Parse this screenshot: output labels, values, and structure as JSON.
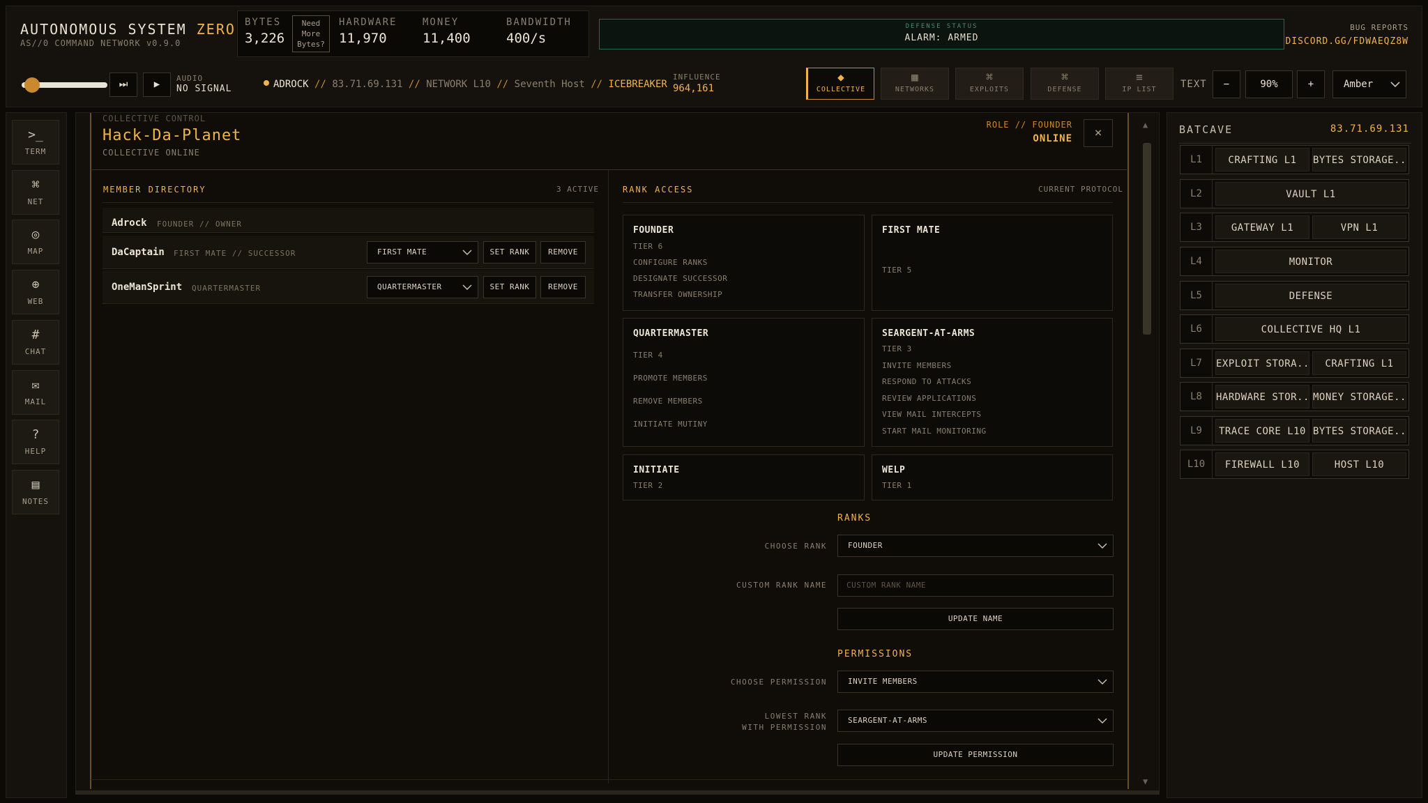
{
  "app": {
    "title_main": "AUTONOMOUS SYSTEM",
    "title_accent": "ZERO",
    "subtitle": "AS//0 COMMAND NETWORK v0.9.0"
  },
  "resources": {
    "bytes_label": "BYTES",
    "bytes_value": "3,226",
    "need_more": [
      "Need",
      "More",
      "Bytes?"
    ],
    "hardware_label": "HARDWARE",
    "hardware_value": "11,970",
    "money_label": "MONEY",
    "money_value": "11,400",
    "bandwidth_label": "BANDWIDTH",
    "bandwidth_value": "400/s"
  },
  "defense_status": {
    "label": "DEFENSE STATUS",
    "value": "ALARM: ARMED",
    "color": "#1f6b52"
  },
  "bug_reports": {
    "label": "BUG REPORTS",
    "link": "DISCORD.GG/FDWAEQZ8W"
  },
  "audio": {
    "label": "AUDIO",
    "status": "NO SIGNAL",
    "volume_fraction": 0.08
  },
  "breadcrumb": {
    "user": "ADROCK",
    "ip": "83.71.69.131",
    "network": "NETWORK L10",
    "host": "Seventh Host",
    "tool": "ICEBREAKER",
    "separator": "//"
  },
  "influence": {
    "label": "INFLUENCE",
    "value": "964,161"
  },
  "nav_tabs": [
    {
      "label": "COLLECTIVE",
      "icon": "diamond-icon",
      "glyph": "◆",
      "active": true
    },
    {
      "label": "NETWORKS",
      "icon": "grid-icon",
      "glyph": "▦",
      "active": false
    },
    {
      "label": "EXPLOITS",
      "icon": "command-icon",
      "glyph": "⌘",
      "active": false
    },
    {
      "label": "DEFENSE",
      "icon": "command-icon",
      "glyph": "⌘",
      "active": false
    },
    {
      "label": "IP LIST",
      "icon": "list-icon",
      "glyph": "≡",
      "active": false
    }
  ],
  "text_controls": {
    "label": "TEXT",
    "minus": "−",
    "zoom": "90%",
    "plus": "+",
    "theme": "Amber"
  },
  "left_rail": [
    {
      "label": "TERM",
      "icon": "terminal-icon",
      "glyph": ">_"
    },
    {
      "label": "NET",
      "icon": "command-icon",
      "glyph": "⌘"
    },
    {
      "label": "MAP",
      "icon": "target-icon",
      "glyph": "◎"
    },
    {
      "label": "WEB",
      "icon": "globe-icon",
      "glyph": "⊕"
    },
    {
      "label": "CHAT",
      "icon": "hash-icon",
      "glyph": "#"
    },
    {
      "label": "MAIL",
      "icon": "mail-icon",
      "glyph": "✉"
    },
    {
      "label": "HELP",
      "icon": "question-icon",
      "glyph": "?"
    },
    {
      "label": "NOTES",
      "icon": "notes-icon",
      "glyph": "▤"
    }
  ],
  "collective": {
    "section_label": "COLLECTIVE CONTROL",
    "name": "Hack-Da-Planet",
    "status": "COLLECTIVE ONLINE",
    "role_label": "ROLE // FOUNDER",
    "role_status": "ONLINE",
    "close": "×"
  },
  "member_directory": {
    "title": "MEMBER DIRECTORY",
    "count": "3 ACTIVE",
    "members": [
      {
        "name": "Adrock",
        "role": "FOUNDER // OWNER"
      },
      {
        "name": "DaCaptain",
        "role": "FIRST MATE // SUCCESSOR",
        "rank_select": "FIRST MATE",
        "set_rank": "SET RANK",
        "remove": "REMOVE"
      },
      {
        "name": "OneManSprint",
        "role": "QUARTERMASTER",
        "rank_select": "QUARTERMASTER",
        "set_rank": "SET RANK",
        "remove": "REMOVE"
      }
    ]
  },
  "rank_access": {
    "title": "RANK ACCESS",
    "right_label": "CURRENT PROTOCOL",
    "cards": [
      {
        "title": "FOUNDER",
        "items": [
          "TIER 6",
          "CONFIGURE RANKS",
          "DESIGNATE SUCCESSOR",
          "TRANSFER OWNERSHIP"
        ]
      },
      {
        "title": "FIRST MATE",
        "items": [
          "TIER 5"
        ]
      },
      {
        "title": "QUARTERMASTER",
        "items": [
          "TIER 4",
          "PROMOTE MEMBERS",
          "REMOVE MEMBERS",
          "INITIATE MUTINY"
        ]
      },
      {
        "title": "SEARGENT-AT-ARMS",
        "items": [
          "TIER 3",
          "INVITE MEMBERS",
          "RESPOND TO ATTACKS",
          "REVIEW APPLICATIONS",
          "VIEW MAIL INTERCEPTS",
          "START MAIL MONITORING"
        ]
      },
      {
        "title": "INITIATE",
        "items": [
          "TIER 2"
        ]
      },
      {
        "title": "WELP",
        "items": [
          "TIER 1"
        ]
      }
    ]
  },
  "ranks_form": {
    "title": "RANKS",
    "choose_rank_label": "CHOOSE RANK",
    "choose_rank_value": "FOUNDER",
    "custom_name_label": "CUSTOM RANK NAME",
    "custom_name_placeholder": "CUSTOM RANK NAME",
    "update_name": "UPDATE NAME"
  },
  "permissions_form": {
    "title": "PERMISSIONS",
    "choose_permission_label": "CHOOSE PERMISSION",
    "choose_permission_value": "INVITE MEMBERS",
    "lowest_rank_label_1": "LOWEST RANK",
    "lowest_rank_label_2": "WITH PERMISSION",
    "lowest_rank_value": "SEARGENT-AT-ARMS",
    "update_permission": "UPDATE PERMISSION"
  },
  "host_panel": {
    "name": "BATCAVE",
    "ip": "83.71.69.131",
    "layers": [
      {
        "level": "L1",
        "slots": [
          "CRAFTING L1",
          "BYTES STORAGE..."
        ]
      },
      {
        "level": "L2",
        "slots": [
          "VAULT L1"
        ]
      },
      {
        "level": "L3",
        "slots": [
          "GATEWAY L1",
          "VPN L1"
        ]
      },
      {
        "level": "L4",
        "slots": [
          "MONITOR"
        ]
      },
      {
        "level": "L5",
        "slots": [
          "DEFENSE"
        ]
      },
      {
        "level": "L6",
        "slots": [
          "COLLECTIVE HQ L1"
        ]
      },
      {
        "level": "L7",
        "slots": [
          "EXPLOIT STORA...",
          "CRAFTING L1"
        ]
      },
      {
        "level": "L8",
        "slots": [
          "HARDWARE STOR...",
          "MONEY STORAGE..."
        ]
      },
      {
        "level": "L9",
        "slots": [
          "TRACE CORE L10",
          "BYTES STORAGE..."
        ]
      },
      {
        "level": "L10",
        "slots": [
          "FIREWALL L10",
          "HOST L10"
        ]
      }
    ]
  },
  "colors": {
    "accent": "#f0b44a",
    "accent_dark": "#c9892f",
    "background": "#0c0a07",
    "defense_border": "#1f6b52"
  }
}
